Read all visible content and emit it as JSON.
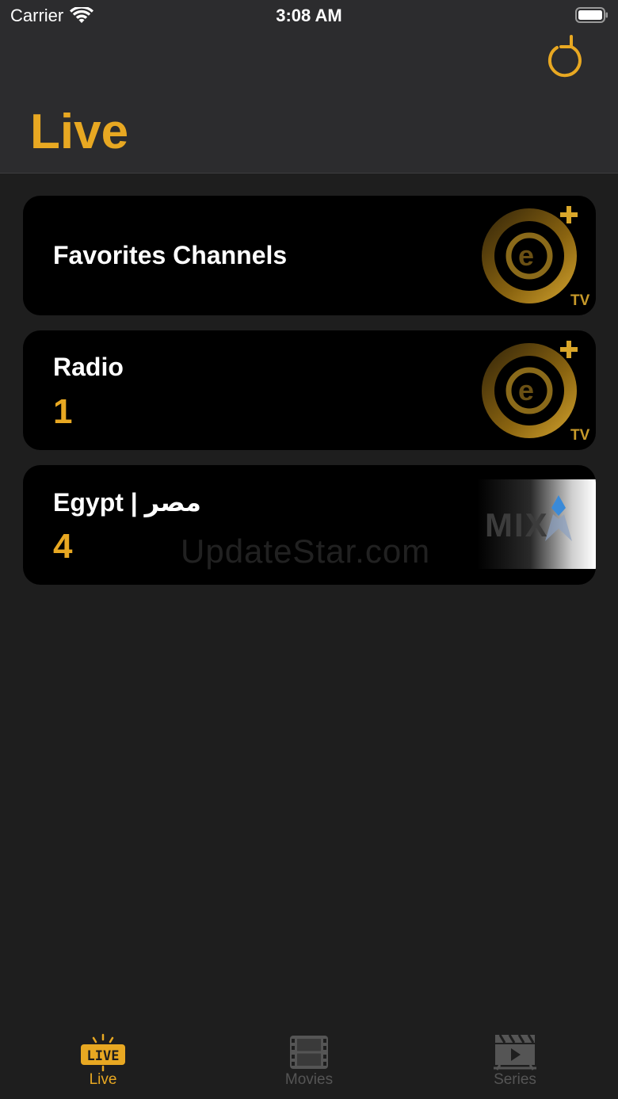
{
  "colors": {
    "accent": "#e8a822",
    "background": "#1e1e1e",
    "header": "#2c2c2e",
    "card": "#000000",
    "inactive": "#555555"
  },
  "status_bar": {
    "carrier": "Carrier",
    "time": "3:08 AM"
  },
  "header": {
    "title": "Live",
    "refresh_icon": "refresh-icon"
  },
  "categories": [
    {
      "title": "Favorites Channels",
      "count": "",
      "logo": "be-tv-logo"
    },
    {
      "title": "Radio",
      "count": "1",
      "logo": "be-tv-logo"
    },
    {
      "title": "Egypt | مصر",
      "count": "4",
      "logo": "mix-logo"
    }
  ],
  "logo_text": {
    "be": "e",
    "tv": "TV",
    "mix": "MIX"
  },
  "watermark": "UpdateStar.com",
  "tabs": [
    {
      "label": "Live",
      "icon": "live-badge-icon",
      "active": true,
      "badge": "LIVE"
    },
    {
      "label": "Movies",
      "icon": "film-icon",
      "active": false
    },
    {
      "label": "Series",
      "icon": "clapper-icon",
      "active": false
    }
  ]
}
